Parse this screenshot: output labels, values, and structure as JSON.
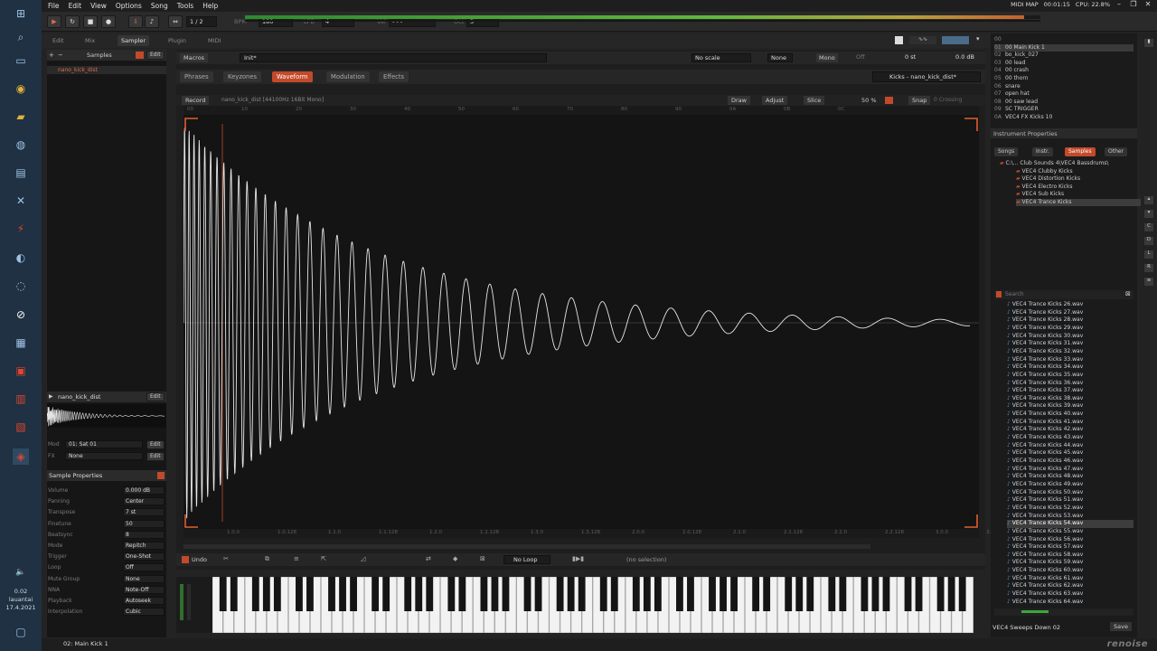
{
  "menu": [
    "File",
    "Edit",
    "View",
    "Options",
    "Song",
    "Tools",
    "Help"
  ],
  "transport": {
    "pattern_label": "1 / 2",
    "bpm_label": "BPM",
    "bpm_value": "180",
    "lpb_label": "LPB",
    "lpb_value": "4",
    "vel_label": "Vel",
    "vel_value": "- - -",
    "oct_label": "Oct",
    "oct_value": "3"
  },
  "sysinfo": {
    "midi": "MIDI MAP",
    "time": "00:01:15",
    "cpu": "CPU: 22.8%"
  },
  "top_tabs": [
    "Edit",
    "Mix",
    "Sampler",
    "Plugin",
    "MIDI"
  ],
  "left_panel": {
    "samples_label": "Samples",
    "edit_label": "Edit",
    "sample_item": "nano_kick_dist",
    "sample_name": "nano_kick_dist",
    "mod_label": "Mod",
    "mod_value": "01: Sat 01",
    "fx_label": "FX",
    "fx_value": "None",
    "props_title": "Sample Properties",
    "props": [
      {
        "label": "Volume",
        "value": "0.000 dB"
      },
      {
        "label": "Panning",
        "value": "Center"
      },
      {
        "label": "Transpose",
        "value": "7 st"
      },
      {
        "label": "Finetune",
        "value": "50"
      },
      {
        "label": "Beatsync",
        "value": "8"
      },
      {
        "label": "Mode",
        "value": "Repitch"
      },
      {
        "label": "Trigger",
        "value": "One-Shot"
      },
      {
        "label": "Loop",
        "value": "Off"
      },
      {
        "label": "Mute Group",
        "value": "None"
      },
      {
        "label": "NNA",
        "value": "Note-Off"
      },
      {
        "label": "Playback",
        "value": "Autoseek"
      },
      {
        "label": "Interpolation",
        "value": "Cubic"
      }
    ]
  },
  "editor": {
    "macros_label": "Macros",
    "init_label": "Init*",
    "scale_label": "No scale",
    "none_label": "None",
    "mono_label": "Mono",
    "off_label": "Off",
    "st_label": "0 st",
    "db_label": "0.0 dB",
    "tabs": [
      "Phrases",
      "Keyzones",
      "Waveform",
      "Modulation",
      "Effects"
    ],
    "kicks_label": "Kicks - nano_kick_dist*",
    "record_label": "Record",
    "sample_info": "nano_kick_dist [44100Hz 16Bit Mono]",
    "draw_label": "Draw",
    "adjust_label": "Adjust",
    "slice_label": "Slice",
    "zoom_label": "50 %",
    "snap_label": "Snap",
    "zero_label": "0 Crossing",
    "ruler_top": [
      "00",
      "10",
      "20",
      "30",
      "40",
      "50",
      "60",
      "70",
      "80",
      "90",
      "0A",
      "0B",
      "0C"
    ],
    "ruler_bottom": [
      "1.0.0",
      "1.0.128",
      "1.1.0",
      "1.1.128",
      "1.2.0",
      "1.2.128",
      "1.3.0",
      "1.3.128",
      "2.0.0",
      "2.0.128",
      "2.1.0",
      "2.1.128",
      "2.2.0",
      "2.2.128",
      "3.0.0",
      "3.0.128"
    ],
    "undo_label": "Undo",
    "noloop_label": "No Loop",
    "selection_label": "(no selection)"
  },
  "instruments": [
    {
      "num": "00",
      "name": ""
    },
    {
      "num": "01",
      "name": "00 Main Kick 1"
    },
    {
      "num": "02",
      "name": "bo_kick_027"
    },
    {
      "num": "03",
      "name": "00 lead"
    },
    {
      "num": "04",
      "name": "00 crash"
    },
    {
      "num": "05",
      "name": "00 thorn"
    },
    {
      "num": "06",
      "name": "snare"
    },
    {
      "num": "07",
      "name": "open hat"
    },
    {
      "num": "08",
      "name": "00 saw lead"
    },
    {
      "num": "09",
      "name": "SC TRIGGER"
    },
    {
      "num": "0A",
      "name": "VEC4 FX Kicks 10"
    }
  ],
  "right_panel": {
    "inst_props": "Instrument Properties",
    "tabs": [
      "Songs",
      "Instr.",
      "Samples",
      "Other"
    ],
    "tree": [
      "C:\\... Club Sounds 4\\VEC4 Bassdrums\\",
      "VEC4 Clubby Kicks",
      "VEC4 Distortion Kicks",
      "VEC4 Electro Kicks",
      "VEC4 Sub Kicks",
      "VEC4 Trance Kicks"
    ],
    "search_label": "Search",
    "files": [
      "VEC4 Trance Kicks 26.wav",
      "VEC4 Trance Kicks 27.wav",
      "VEC4 Trance Kicks 28.wav",
      "VEC4 Trance Kicks 29.wav",
      "VEC4 Trance Kicks 30.wav",
      "VEC4 Trance Kicks 31.wav",
      "VEC4 Trance Kicks 32.wav",
      "VEC4 Trance Kicks 33.wav",
      "VEC4 Trance Kicks 34.wav",
      "VEC4 Trance Kicks 35.wav",
      "VEC4 Trance Kicks 36.wav",
      "VEC4 Trance Kicks 37.wav",
      "VEC4 Trance Kicks 38.wav",
      "VEC4 Trance Kicks 39.wav",
      "VEC4 Trance Kicks 40.wav",
      "VEC4 Trance Kicks 41.wav",
      "VEC4 Trance Kicks 42.wav",
      "VEC4 Trance Kicks 43.wav",
      "VEC4 Trance Kicks 44.wav",
      "VEC4 Trance Kicks 45.wav",
      "VEC4 Trance Kicks 46.wav",
      "VEC4 Trance Kicks 47.wav",
      "VEC4 Trance Kicks 48.wav",
      "VEC4 Trance Kicks 49.wav",
      "VEC4 Trance Kicks 50.wav",
      "VEC4 Trance Kicks 51.wav",
      "VEC4 Trance Kicks 52.wav",
      "VEC4 Trance Kicks 53.wav",
      "VEC4 Trance Kicks 54.wav",
      "VEC4 Trance Kicks 55.wav",
      "VEC4 Trance Kicks 56.wav",
      "VEC4 Trance Kicks 57.wav",
      "VEC4 Trance Kicks 58.wav",
      "VEC4 Trance Kicks 59.wav",
      "VEC4 Trance Kicks 60.wav",
      "VEC4 Trance Kicks 61.wav",
      "VEC4 Trance Kicks 62.wav",
      "VEC4 Trance Kicks 63.wav",
      "VEC4 Trance Kicks 64.wav"
    ],
    "selected_file_index": 28,
    "preview_label": "VEC4 Sweeps Down 02",
    "save_label": "Save"
  },
  "taskbar": {
    "time": "0.02",
    "day": "lauantai",
    "date": "17.4.2021"
  },
  "status": {
    "text": "02: Main Kick 1",
    "logo": "renoise"
  },
  "colors": {
    "accent": "#c24a2b",
    "waveform": "#e6e6e6",
    "background": "#141414"
  }
}
